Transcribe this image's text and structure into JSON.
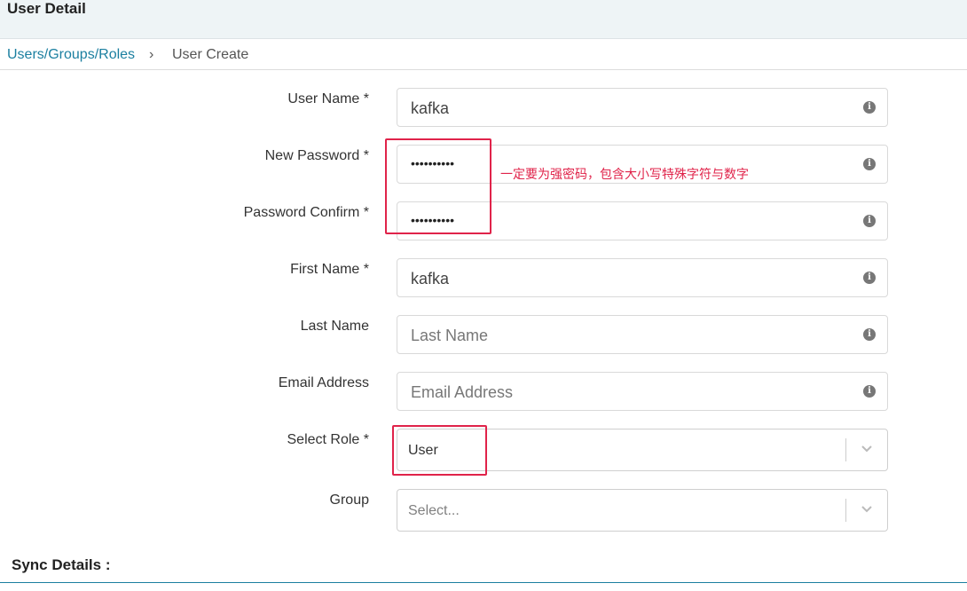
{
  "header": {
    "title": "User Detail"
  },
  "breadcrumb": {
    "link": "Users/Groups/Roles",
    "separator": "›",
    "current": "User Create"
  },
  "form": {
    "username": {
      "label": "User Name *",
      "value": "kafka"
    },
    "new_password": {
      "label": "New Password *",
      "value": "••••••••••"
    },
    "password_confirm": {
      "label": "Password Confirm *",
      "value": "••••••••••"
    },
    "first_name": {
      "label": "First Name *",
      "value": "kafka"
    },
    "last_name": {
      "label": "Last Name",
      "placeholder": "Last Name"
    },
    "email": {
      "label": "Email Address",
      "placeholder": "Email Address"
    },
    "role": {
      "label": "Select Role *",
      "value": "User"
    },
    "group": {
      "label": "Group",
      "placeholder": "Select..."
    }
  },
  "annotation": {
    "text": "一定要为强密码，包含大小写特殊字符与数字",
    "color": "#e0234a"
  },
  "sections": {
    "sync_details": "Sync Details :"
  },
  "icons": {
    "info": "info-icon",
    "dropdown": "chevron-down-icon"
  },
  "colors": {
    "link": "#1b7fa0",
    "annotation": "#e0234a"
  }
}
